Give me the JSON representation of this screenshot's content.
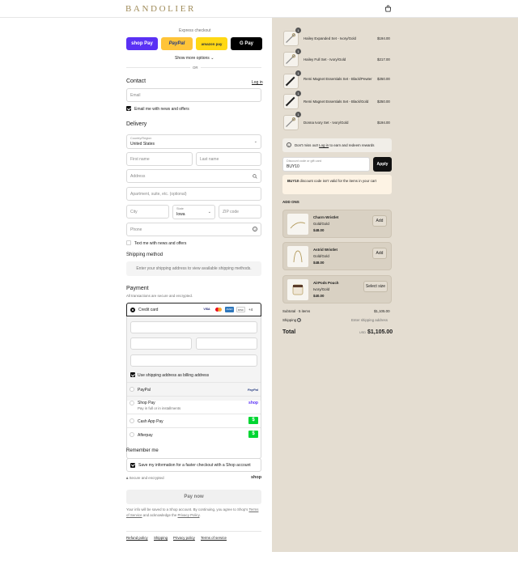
{
  "header": {
    "brand": "BANDOLIER"
  },
  "express": {
    "title": "Express checkout",
    "buttons": [
      {
        "label": "shop Pay",
        "color": "#5a31f4"
      },
      {
        "label": "PayPal",
        "color": "#ffc439"
      },
      {
        "label": "amazon pay",
        "color": "#ffd814"
      },
      {
        "label": "G Pay",
        "color": "#000000"
      }
    ],
    "show_more": "Show more options",
    "or": "OR"
  },
  "contact": {
    "heading": "Contact",
    "login": "Log in",
    "email_placeholder": "Email",
    "news_label": "Email me with news and offers"
  },
  "delivery": {
    "heading": "Delivery",
    "country_label": "Country/Region",
    "country_value": "United States",
    "first_name": "First name",
    "last_name": "Last name",
    "address": "Address",
    "apartment": "Apartment, suite, etc. (optional)",
    "city": "City",
    "state_label": "State",
    "state_value": "Iowa",
    "zip": "ZIP code",
    "phone": "Phone",
    "text_label": "Text me with news and offers"
  },
  "shipping": {
    "heading": "Shipping method",
    "note": "Enter your shipping address to view available shipping methods."
  },
  "payment": {
    "heading": "Payment",
    "subtext": "All transactions are secure and encrypted.",
    "credit_card": "Credit card",
    "card_badges": [
      "VISA",
      "MC",
      "AMEX",
      "DISC",
      "+4"
    ],
    "billing_label": "Use shipping address as billing address",
    "options": [
      {
        "label": "PayPal",
        "sub": "",
        "badge": "PayPal"
      },
      {
        "label": "Shop Pay",
        "sub": "Pay in full or in installments",
        "badge": "shop"
      },
      {
        "label": "Cash App Pay",
        "sub": "",
        "badge": "$"
      },
      {
        "label": "Afterpay",
        "sub": "",
        "badge": "$"
      }
    ]
  },
  "remember": {
    "heading": "Remember me",
    "save_label": "Save my information for a faster checkout with a Shop account",
    "secure": "Secure and encrypted",
    "shop": "shop"
  },
  "pay_now": "Pay now",
  "legal": {
    "text1": "Your info will be saved to a Shop account. By continuing, you agree to Shop's",
    "terms": "Terms of Service",
    "text2": "and acknowledge the",
    "privacy": "Privacy Policy",
    "end": "."
  },
  "footer_links": [
    "Refund policy",
    "Shipping",
    "Privacy policy",
    "Terms of service"
  ],
  "cart": {
    "items": [
      {
        "name": "Hailey Expanded Set - Ivory/Gold",
        "price": "$194.00",
        "qty": "1"
      },
      {
        "name": "Hailey Full Set - Ivory/Gold",
        "price": "$217.00",
        "qty": "1"
      },
      {
        "name": "Remi Magnet Essentials Set - Black/Pewter",
        "price": "$250.00",
        "qty": "1"
      },
      {
        "name": "Remi Magnet Essentials Set - Black/Gold",
        "price": "$250.00",
        "qty": "1"
      },
      {
        "name": "Donna Ivory Set - Ivory/Gold",
        "price": "$194.00",
        "qty": "1"
      }
    ],
    "rewards_pre": "Don't miss out!",
    "rewards_link": "Log in",
    "rewards_post": "to earn and redeem rewards",
    "discount_label": "Discount code or gift card",
    "discount_value": "BUY10",
    "apply": "Apply",
    "discount_error_code": "BUY10",
    "discount_error_text": "discount code isn't valid for the items in your cart",
    "addons_heading": "ADD ONS",
    "addons": [
      {
        "name": "Charm Wristlet",
        "variant": "Gold/Gold",
        "price": "$48.00",
        "action": "Add"
      },
      {
        "name": "Astrid Wristlet",
        "variant": "Gold/Gold",
        "price": "$48.00",
        "action": "Add"
      },
      {
        "name": "AirPods Pouch",
        "variant": "Ivory/Gold",
        "price": "$40.00",
        "action": "Select size"
      }
    ],
    "subtotal_label": "Subtotal · 5 items",
    "subtotal": "$1,105.00",
    "shipping_label": "Shipping",
    "shipping_value": "Enter shipping address",
    "total_label": "Total",
    "currency": "USD",
    "total": "$1,105.00"
  }
}
